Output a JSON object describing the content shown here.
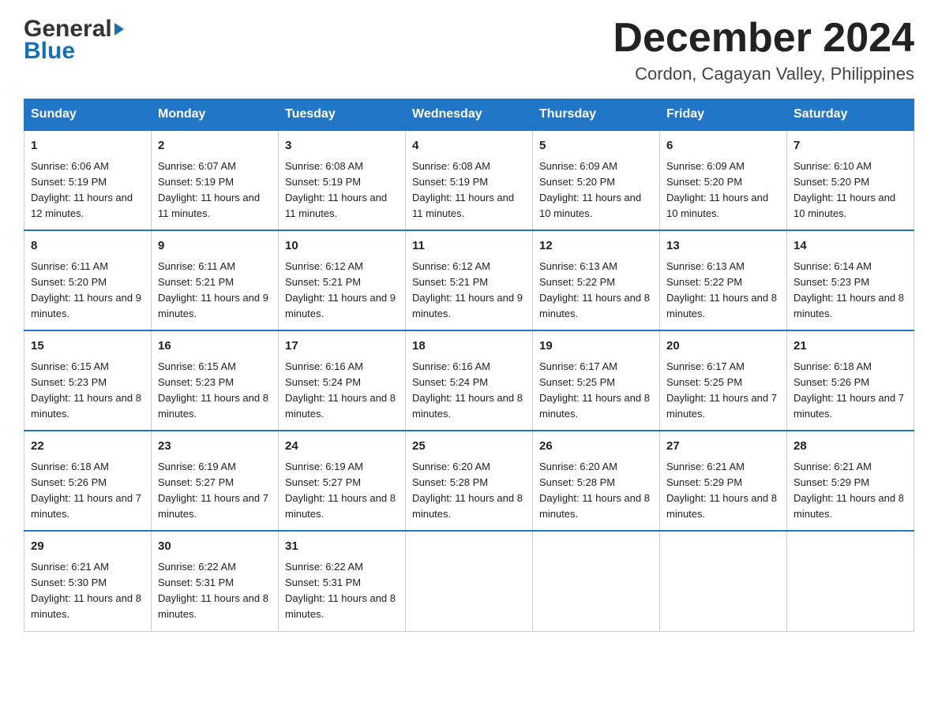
{
  "header": {
    "logo_line1": "General",
    "logo_line2": "Blue",
    "month_title": "December 2024",
    "subtitle": "Cordon, Cagayan Valley, Philippines"
  },
  "weekdays": [
    "Sunday",
    "Monday",
    "Tuesday",
    "Wednesday",
    "Thursday",
    "Friday",
    "Saturday"
  ],
  "weeks": [
    [
      {
        "day": "1",
        "sunrise": "Sunrise: 6:06 AM",
        "sunset": "Sunset: 5:19 PM",
        "daylight": "Daylight: 11 hours and 12 minutes."
      },
      {
        "day": "2",
        "sunrise": "Sunrise: 6:07 AM",
        "sunset": "Sunset: 5:19 PM",
        "daylight": "Daylight: 11 hours and 11 minutes."
      },
      {
        "day": "3",
        "sunrise": "Sunrise: 6:08 AM",
        "sunset": "Sunset: 5:19 PM",
        "daylight": "Daylight: 11 hours and 11 minutes."
      },
      {
        "day": "4",
        "sunrise": "Sunrise: 6:08 AM",
        "sunset": "Sunset: 5:19 PM",
        "daylight": "Daylight: 11 hours and 11 minutes."
      },
      {
        "day": "5",
        "sunrise": "Sunrise: 6:09 AM",
        "sunset": "Sunset: 5:20 PM",
        "daylight": "Daylight: 11 hours and 10 minutes."
      },
      {
        "day": "6",
        "sunrise": "Sunrise: 6:09 AM",
        "sunset": "Sunset: 5:20 PM",
        "daylight": "Daylight: 11 hours and 10 minutes."
      },
      {
        "day": "7",
        "sunrise": "Sunrise: 6:10 AM",
        "sunset": "Sunset: 5:20 PM",
        "daylight": "Daylight: 11 hours and 10 minutes."
      }
    ],
    [
      {
        "day": "8",
        "sunrise": "Sunrise: 6:11 AM",
        "sunset": "Sunset: 5:20 PM",
        "daylight": "Daylight: 11 hours and 9 minutes."
      },
      {
        "day": "9",
        "sunrise": "Sunrise: 6:11 AM",
        "sunset": "Sunset: 5:21 PM",
        "daylight": "Daylight: 11 hours and 9 minutes."
      },
      {
        "day": "10",
        "sunrise": "Sunrise: 6:12 AM",
        "sunset": "Sunset: 5:21 PM",
        "daylight": "Daylight: 11 hours and 9 minutes."
      },
      {
        "day": "11",
        "sunrise": "Sunrise: 6:12 AM",
        "sunset": "Sunset: 5:21 PM",
        "daylight": "Daylight: 11 hours and 9 minutes."
      },
      {
        "day": "12",
        "sunrise": "Sunrise: 6:13 AM",
        "sunset": "Sunset: 5:22 PM",
        "daylight": "Daylight: 11 hours and 8 minutes."
      },
      {
        "day": "13",
        "sunrise": "Sunrise: 6:13 AM",
        "sunset": "Sunset: 5:22 PM",
        "daylight": "Daylight: 11 hours and 8 minutes."
      },
      {
        "day": "14",
        "sunrise": "Sunrise: 6:14 AM",
        "sunset": "Sunset: 5:23 PM",
        "daylight": "Daylight: 11 hours and 8 minutes."
      }
    ],
    [
      {
        "day": "15",
        "sunrise": "Sunrise: 6:15 AM",
        "sunset": "Sunset: 5:23 PM",
        "daylight": "Daylight: 11 hours and 8 minutes."
      },
      {
        "day": "16",
        "sunrise": "Sunrise: 6:15 AM",
        "sunset": "Sunset: 5:23 PM",
        "daylight": "Daylight: 11 hours and 8 minutes."
      },
      {
        "day": "17",
        "sunrise": "Sunrise: 6:16 AM",
        "sunset": "Sunset: 5:24 PM",
        "daylight": "Daylight: 11 hours and 8 minutes."
      },
      {
        "day": "18",
        "sunrise": "Sunrise: 6:16 AM",
        "sunset": "Sunset: 5:24 PM",
        "daylight": "Daylight: 11 hours and 8 minutes."
      },
      {
        "day": "19",
        "sunrise": "Sunrise: 6:17 AM",
        "sunset": "Sunset: 5:25 PM",
        "daylight": "Daylight: 11 hours and 8 minutes."
      },
      {
        "day": "20",
        "sunrise": "Sunrise: 6:17 AM",
        "sunset": "Sunset: 5:25 PM",
        "daylight": "Daylight: 11 hours and 7 minutes."
      },
      {
        "day": "21",
        "sunrise": "Sunrise: 6:18 AM",
        "sunset": "Sunset: 5:26 PM",
        "daylight": "Daylight: 11 hours and 7 minutes."
      }
    ],
    [
      {
        "day": "22",
        "sunrise": "Sunrise: 6:18 AM",
        "sunset": "Sunset: 5:26 PM",
        "daylight": "Daylight: 11 hours and 7 minutes."
      },
      {
        "day": "23",
        "sunrise": "Sunrise: 6:19 AM",
        "sunset": "Sunset: 5:27 PM",
        "daylight": "Daylight: 11 hours and 7 minutes."
      },
      {
        "day": "24",
        "sunrise": "Sunrise: 6:19 AM",
        "sunset": "Sunset: 5:27 PM",
        "daylight": "Daylight: 11 hours and 8 minutes."
      },
      {
        "day": "25",
        "sunrise": "Sunrise: 6:20 AM",
        "sunset": "Sunset: 5:28 PM",
        "daylight": "Daylight: 11 hours and 8 minutes."
      },
      {
        "day": "26",
        "sunrise": "Sunrise: 6:20 AM",
        "sunset": "Sunset: 5:28 PM",
        "daylight": "Daylight: 11 hours and 8 minutes."
      },
      {
        "day": "27",
        "sunrise": "Sunrise: 6:21 AM",
        "sunset": "Sunset: 5:29 PM",
        "daylight": "Daylight: 11 hours and 8 minutes."
      },
      {
        "day": "28",
        "sunrise": "Sunrise: 6:21 AM",
        "sunset": "Sunset: 5:29 PM",
        "daylight": "Daylight: 11 hours and 8 minutes."
      }
    ],
    [
      {
        "day": "29",
        "sunrise": "Sunrise: 6:21 AM",
        "sunset": "Sunset: 5:30 PM",
        "daylight": "Daylight: 11 hours and 8 minutes."
      },
      {
        "day": "30",
        "sunrise": "Sunrise: 6:22 AM",
        "sunset": "Sunset: 5:31 PM",
        "daylight": "Daylight: 11 hours and 8 minutes."
      },
      {
        "day": "31",
        "sunrise": "Sunrise: 6:22 AM",
        "sunset": "Sunset: 5:31 PM",
        "daylight": "Daylight: 11 hours and 8 minutes."
      },
      null,
      null,
      null,
      null
    ]
  ]
}
